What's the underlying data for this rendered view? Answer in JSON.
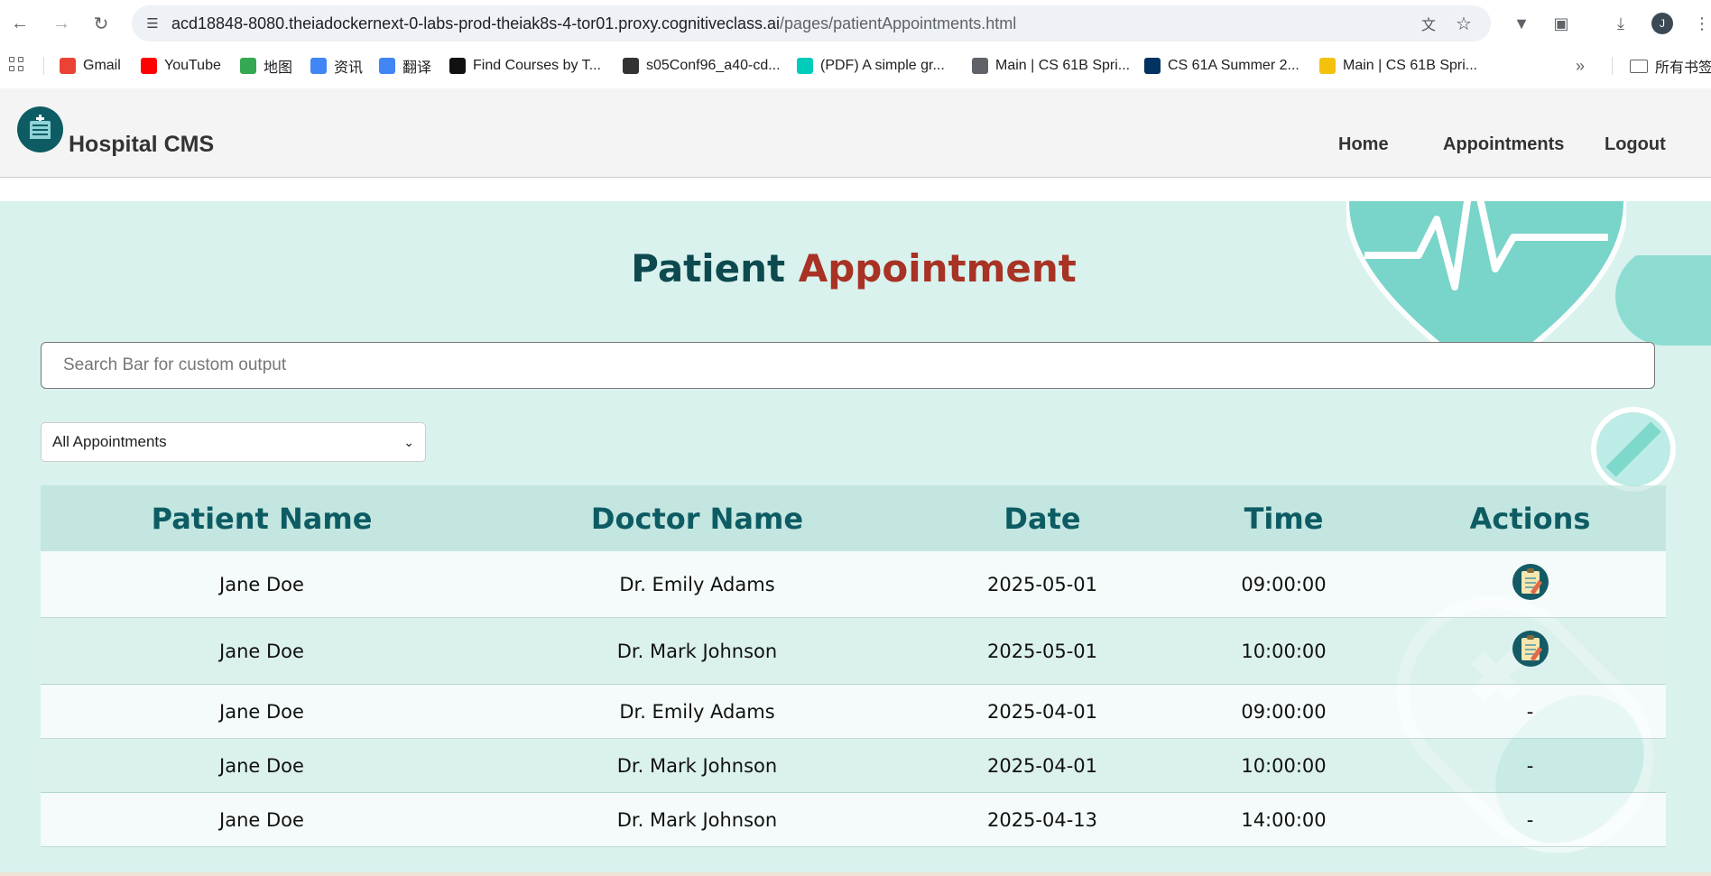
{
  "browser": {
    "url_main": "acd18848-8080.theiadockernext-0-labs-prod-theiak8s-4-tor01.proxy.cognitiveclass.ai",
    "url_path": "/pages/patientAppointments.html",
    "avatar_letter": "J"
  },
  "bookmarks": [
    {
      "label": "Gmail",
      "icon": "gmail-icon",
      "color": "#ea4335"
    },
    {
      "label": "YouTube",
      "icon": "youtube-icon",
      "color": "#ff0000"
    },
    {
      "label": "地图",
      "icon": "maps-icon",
      "color": "#34a853"
    },
    {
      "label": "资讯",
      "icon": "news-icon",
      "color": "#4285f4"
    },
    {
      "label": "翻译",
      "icon": "translate-icon",
      "color": "#4285f4"
    },
    {
      "label": "Find Courses by T...",
      "icon": "courses-icon",
      "color": "#111111"
    },
    {
      "label": "s05Conf96_a40-cd...",
      "icon": "conf-icon",
      "color": "#333333"
    },
    {
      "label": "(PDF) A simple gr...",
      "icon": "researchgate-icon",
      "color": "#00ccbb"
    },
    {
      "label": "Main | CS 61B Spri...",
      "icon": "globe-icon",
      "color": "#5f6368"
    },
    {
      "label": "CS 61A Summer 2...",
      "icon": "berkeley-icon",
      "color": "#003262"
    },
    {
      "label": "Main | CS 61B Spri...",
      "icon": "smiley-icon",
      "color": "#f4c20d"
    }
  ],
  "bookmarks_folder": "所有书签",
  "site": {
    "brand": "Hospital CMS",
    "nav": [
      "Home",
      "Appointments",
      "Logout"
    ]
  },
  "main": {
    "title_part1": "Patient",
    "title_part2": "Appointment",
    "search_placeholder": "Search Bar for custom output",
    "filter_selected": "All Appointments"
  },
  "table": {
    "headers": [
      "Patient Name",
      "Doctor Name",
      "Date",
      "Time",
      "Actions"
    ],
    "rows": [
      {
        "patient": "Jane Doe",
        "doctor": "Dr. Emily Adams",
        "date": "2025-05-01",
        "time": "09:00:00",
        "action": "icon"
      },
      {
        "patient": "Jane Doe",
        "doctor": "Dr. Mark Johnson",
        "date": "2025-05-01",
        "time": "10:00:00",
        "action": "icon"
      },
      {
        "patient": "Jane Doe",
        "doctor": "Dr. Emily Adams",
        "date": "2025-04-01",
        "time": "09:00:00",
        "action": "-"
      },
      {
        "patient": "Jane Doe",
        "doctor": "Dr. Mark Johnson",
        "date": "2025-04-01",
        "time": "10:00:00",
        "action": "-"
      },
      {
        "patient": "Jane Doe",
        "doctor": "Dr. Mark Johnson",
        "date": "2025-04-13",
        "time": "14:00:00",
        "action": "-"
      }
    ]
  },
  "colors": {
    "title_dark": "#0d4a4f",
    "title_accent": "#a83224",
    "header_text": "#0d5c63",
    "hero_bg": "#d9f2ee"
  }
}
